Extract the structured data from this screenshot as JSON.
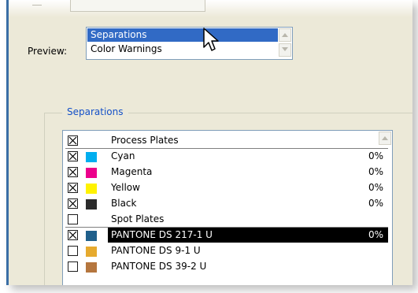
{
  "preview": {
    "label": "Preview:",
    "options": [
      "Separations",
      "Color Warnings"
    ],
    "selected": "Separations"
  },
  "separations": {
    "group_title": "Separations",
    "rows": [
      {
        "kind": "header",
        "checked": true,
        "name": "Process Plates"
      },
      {
        "kind": "item",
        "checked": true,
        "swatch": "#00aeef",
        "name": "Cyan",
        "percent": "0%"
      },
      {
        "kind": "item",
        "checked": true,
        "swatch": "#ec008c",
        "name": "Magenta",
        "percent": "0%"
      },
      {
        "kind": "item",
        "checked": true,
        "swatch": "#fff200",
        "name": "Yellow",
        "percent": "0%"
      },
      {
        "kind": "item",
        "checked": true,
        "swatch": "#2b2b2b",
        "name": "Black",
        "percent": "0%"
      },
      {
        "kind": "header",
        "checked": false,
        "name": "Spot Plates"
      },
      {
        "kind": "item",
        "checked": true,
        "swatch": "#1f5f8b",
        "name": "PANTONE DS 217-1 U",
        "percent": "0%",
        "highlighted": true
      },
      {
        "kind": "item",
        "checked": false,
        "swatch": "#e6aa2e",
        "name": "PANTONE DS 9-1 U",
        "percent": ""
      },
      {
        "kind": "item",
        "checked": false,
        "swatch": "#b5763e",
        "name": "PANTONE DS 39-2 U",
        "percent": ""
      }
    ]
  }
}
